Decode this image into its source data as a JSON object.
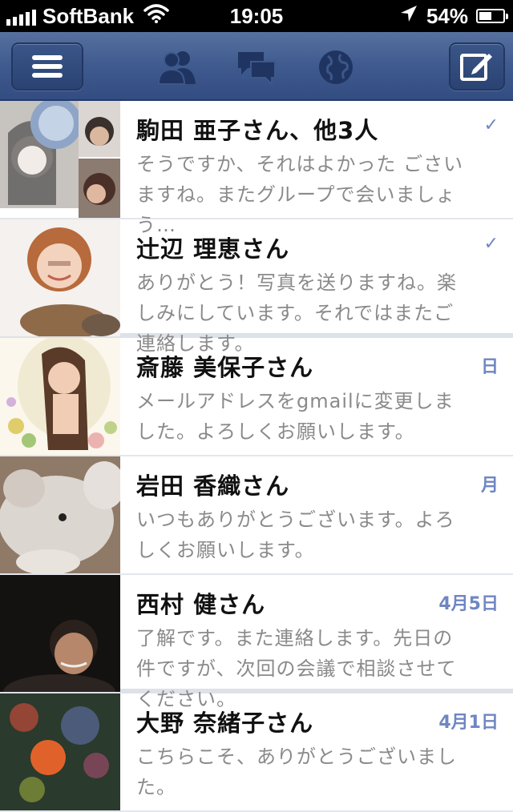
{
  "status_bar": {
    "carrier": "SoftBank",
    "time": "19:05",
    "battery_percent": "54%",
    "battery_level": 0.54,
    "signal_icon": "signal-bars-icon",
    "wifi_icon": "wifi-icon",
    "location_icon": "location-arrow-icon"
  },
  "nav_bar": {
    "menu_icon": "hamburger-menu-icon",
    "center_icons": [
      "friend-requests-icon",
      "messages-icon",
      "notifications-globe-icon"
    ],
    "compose_icon": "compose-message-icon",
    "accent_color": "#3b5998"
  },
  "threads": [
    {
      "name": "駒田 亜子さん、他3人",
      "snippet": "そうですか、それはよかった ごさいますね。またグループで会いましょう…",
      "date": "✓"
    },
    {
      "name": "辻辺 理恵さん",
      "snippet": "ありがとう！写真を送りますね。楽しみにしています。それではまたご連絡します。",
      "date": "✓"
    },
    {
      "name": "斎藤 美保子さん",
      "snippet": "メールアドレスをgmailに変更しました。よろしくお願いします。",
      "date": "日"
    },
    {
      "name": "岩田 香織さん",
      "snippet": "いつもありがとうございます。よろしくお願いします。",
      "date": "月"
    },
    {
      "name": "西村 健さん",
      "snippet": "了解です。また連絡します。先日の件ですが、次回の会議で相談させてください。",
      "date": "4月5日"
    },
    {
      "name": "大野 奈緒子さん",
      "snippet": "こちらこそ、ありがとうございました。",
      "date": "4月1日"
    }
  ]
}
